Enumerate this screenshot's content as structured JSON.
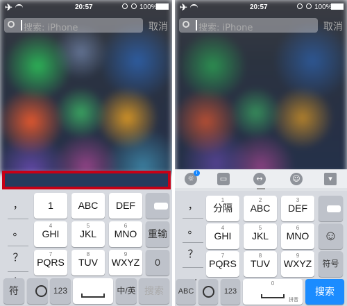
{
  "status": {
    "time": "20:57",
    "battery": "100%"
  },
  "search": {
    "placeholder": "搜索: iPhone",
    "cancel": "取消"
  },
  "left": {
    "side": [
      "，",
      "。",
      "？",
      "！"
    ],
    "rows": [
      [
        "1",
        "ABC",
        "DEF"
      ],
      [
        "GHI",
        "JKL",
        "MNO"
      ],
      [
        "PQRS",
        "TUV",
        "WXYZ"
      ]
    ],
    "superscripts": [
      "4",
      "5",
      "6",
      "7",
      "8",
      "9"
    ],
    "right_keys": [
      "重输",
      "0"
    ],
    "bottom": [
      "符",
      "123",
      "中/英",
      "搜索"
    ]
  },
  "right": {
    "side": [
      "，",
      "。",
      "？",
      "..."
    ],
    "rows": [
      [
        "分隔",
        "ABC",
        "DEF"
      ],
      [
        "GHI",
        "JKL",
        "MNO"
      ],
      [
        "PQRS",
        "TUV",
        "WXYZ"
      ]
    ],
    "superscripts": [
      "1",
      "2",
      "3",
      "4",
      "5",
      "6",
      "7",
      "8",
      "9"
    ],
    "right_keys": [
      "☺",
      "符号"
    ],
    "bottom": [
      "ABC",
      "123",
      "0",
      "拼音",
      "搜索"
    ]
  }
}
